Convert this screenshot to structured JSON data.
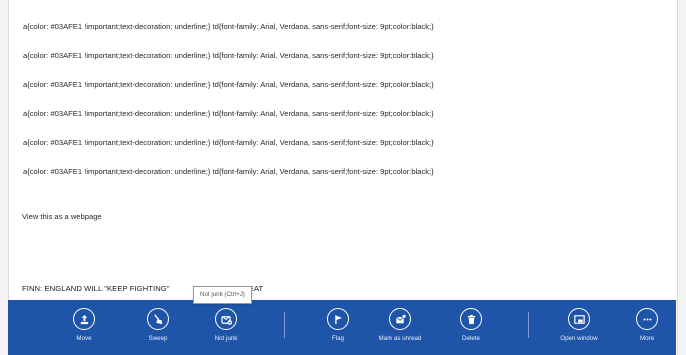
{
  "message": {
    "css_lines": [
      "a{color: #03AFE1 !important;text-decoration: underline;} td{font-family: Arial, Verdana, sans-serif;font-size: 9pt;color:black;}",
      "a{color: #03AFE1 !important;text-decoration: underline;} td{font-family: Arial, Verdana, sans-serif;font-size: 9pt;color:black;}",
      "a{color: #03AFE1 !important;text-decoration: underline;} td{font-family: Arial, Verdana, sans-serif;font-size: 9pt;color:black;}",
      "a{color: #03AFE1 !important;text-decoration: underline;} td{font-family: Arial, Verdana, sans-serif;font-size: 9pt;color:black;}",
      "a{color: #03AFE1 !important;text-decoration: underline;} td{font-family: Arial, Verdana, sans-serif;font-size: 9pt;color:black;}",
      "a{color: #03AFE1 !important;text-decoration: underline;} td{font-family: Arial, Verdana, sans-serif;font-size: 9pt;color:black;}"
    ],
    "webpage_link": "View this as a webpage",
    "headline_start": "FINN: ENGLAND WILL \"KEEP FIGHTING\"",
    "headline_end": "FEAT"
  },
  "tooltip": "Not junk (Ctrl+J)",
  "appbar": {
    "color": "#1f55a9",
    "commands": [
      {
        "label": "Move",
        "icon": "move-icon"
      },
      {
        "label": "Sweep",
        "icon": "sweep-icon"
      },
      {
        "label": "Not junk",
        "icon": "not-junk-icon"
      },
      {
        "label": "Flag",
        "icon": "flag-icon"
      },
      {
        "label": "Mark as unread",
        "icon": "mark-unread-icon"
      },
      {
        "label": "Delete",
        "icon": "delete-icon"
      },
      {
        "label": "Open window",
        "icon": "open-window-icon"
      },
      {
        "label": "More",
        "icon": "more-icon"
      }
    ]
  }
}
